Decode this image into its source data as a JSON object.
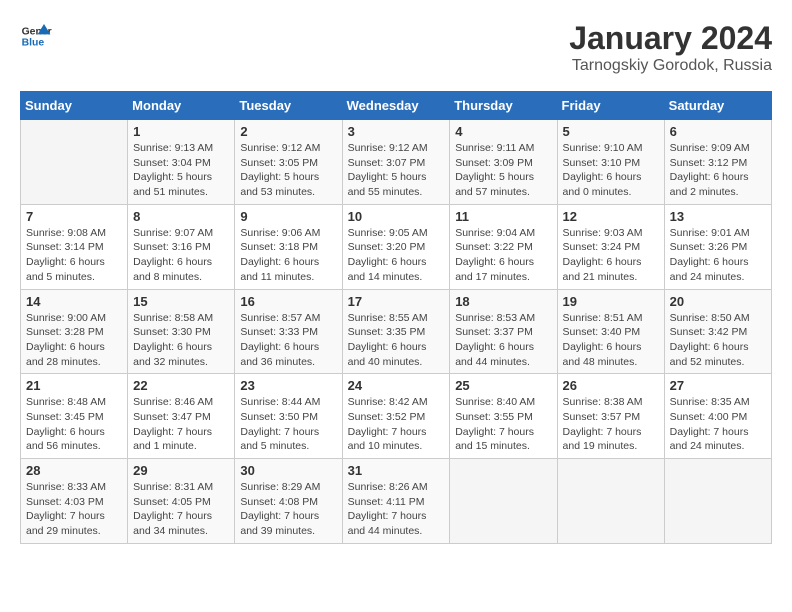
{
  "logo": {
    "line1": "General",
    "line2": "Blue"
  },
  "title": "January 2024",
  "subtitle": "Tarnogskiy Gorodok, Russia",
  "headers": [
    "Sunday",
    "Monday",
    "Tuesday",
    "Wednesday",
    "Thursday",
    "Friday",
    "Saturday"
  ],
  "weeks": [
    [
      {
        "day": "",
        "sunrise": "",
        "sunset": "",
        "daylight": ""
      },
      {
        "day": "1",
        "sunrise": "Sunrise: 9:13 AM",
        "sunset": "Sunset: 3:04 PM",
        "daylight": "Daylight: 5 hours and 51 minutes."
      },
      {
        "day": "2",
        "sunrise": "Sunrise: 9:12 AM",
        "sunset": "Sunset: 3:05 PM",
        "daylight": "Daylight: 5 hours and 53 minutes."
      },
      {
        "day": "3",
        "sunrise": "Sunrise: 9:12 AM",
        "sunset": "Sunset: 3:07 PM",
        "daylight": "Daylight: 5 hours and 55 minutes."
      },
      {
        "day": "4",
        "sunrise": "Sunrise: 9:11 AM",
        "sunset": "Sunset: 3:09 PM",
        "daylight": "Daylight: 5 hours and 57 minutes."
      },
      {
        "day": "5",
        "sunrise": "Sunrise: 9:10 AM",
        "sunset": "Sunset: 3:10 PM",
        "daylight": "Daylight: 6 hours and 0 minutes."
      },
      {
        "day": "6",
        "sunrise": "Sunrise: 9:09 AM",
        "sunset": "Sunset: 3:12 PM",
        "daylight": "Daylight: 6 hours and 2 minutes."
      }
    ],
    [
      {
        "day": "7",
        "sunrise": "Sunrise: 9:08 AM",
        "sunset": "Sunset: 3:14 PM",
        "daylight": "Daylight: 6 hours and 5 minutes."
      },
      {
        "day": "8",
        "sunrise": "Sunrise: 9:07 AM",
        "sunset": "Sunset: 3:16 PM",
        "daylight": "Daylight: 6 hours and 8 minutes."
      },
      {
        "day": "9",
        "sunrise": "Sunrise: 9:06 AM",
        "sunset": "Sunset: 3:18 PM",
        "daylight": "Daylight: 6 hours and 11 minutes."
      },
      {
        "day": "10",
        "sunrise": "Sunrise: 9:05 AM",
        "sunset": "Sunset: 3:20 PM",
        "daylight": "Daylight: 6 hours and 14 minutes."
      },
      {
        "day": "11",
        "sunrise": "Sunrise: 9:04 AM",
        "sunset": "Sunset: 3:22 PM",
        "daylight": "Daylight: 6 hours and 17 minutes."
      },
      {
        "day": "12",
        "sunrise": "Sunrise: 9:03 AM",
        "sunset": "Sunset: 3:24 PM",
        "daylight": "Daylight: 6 hours and 21 minutes."
      },
      {
        "day": "13",
        "sunrise": "Sunrise: 9:01 AM",
        "sunset": "Sunset: 3:26 PM",
        "daylight": "Daylight: 6 hours and 24 minutes."
      }
    ],
    [
      {
        "day": "14",
        "sunrise": "Sunrise: 9:00 AM",
        "sunset": "Sunset: 3:28 PM",
        "daylight": "Daylight: 6 hours and 28 minutes."
      },
      {
        "day": "15",
        "sunrise": "Sunrise: 8:58 AM",
        "sunset": "Sunset: 3:30 PM",
        "daylight": "Daylight: 6 hours and 32 minutes."
      },
      {
        "day": "16",
        "sunrise": "Sunrise: 8:57 AM",
        "sunset": "Sunset: 3:33 PM",
        "daylight": "Daylight: 6 hours and 36 minutes."
      },
      {
        "day": "17",
        "sunrise": "Sunrise: 8:55 AM",
        "sunset": "Sunset: 3:35 PM",
        "daylight": "Daylight: 6 hours and 40 minutes."
      },
      {
        "day": "18",
        "sunrise": "Sunrise: 8:53 AM",
        "sunset": "Sunset: 3:37 PM",
        "daylight": "Daylight: 6 hours and 44 minutes."
      },
      {
        "day": "19",
        "sunrise": "Sunrise: 8:51 AM",
        "sunset": "Sunset: 3:40 PM",
        "daylight": "Daylight: 6 hours and 48 minutes."
      },
      {
        "day": "20",
        "sunrise": "Sunrise: 8:50 AM",
        "sunset": "Sunset: 3:42 PM",
        "daylight": "Daylight: 6 hours and 52 minutes."
      }
    ],
    [
      {
        "day": "21",
        "sunrise": "Sunrise: 8:48 AM",
        "sunset": "Sunset: 3:45 PM",
        "daylight": "Daylight: 6 hours and 56 minutes."
      },
      {
        "day": "22",
        "sunrise": "Sunrise: 8:46 AM",
        "sunset": "Sunset: 3:47 PM",
        "daylight": "Daylight: 7 hours and 1 minute."
      },
      {
        "day": "23",
        "sunrise": "Sunrise: 8:44 AM",
        "sunset": "Sunset: 3:50 PM",
        "daylight": "Daylight: 7 hours and 5 minutes."
      },
      {
        "day": "24",
        "sunrise": "Sunrise: 8:42 AM",
        "sunset": "Sunset: 3:52 PM",
        "daylight": "Daylight: 7 hours and 10 minutes."
      },
      {
        "day": "25",
        "sunrise": "Sunrise: 8:40 AM",
        "sunset": "Sunset: 3:55 PM",
        "daylight": "Daylight: 7 hours and 15 minutes."
      },
      {
        "day": "26",
        "sunrise": "Sunrise: 8:38 AM",
        "sunset": "Sunset: 3:57 PM",
        "daylight": "Daylight: 7 hours and 19 minutes."
      },
      {
        "day": "27",
        "sunrise": "Sunrise: 8:35 AM",
        "sunset": "Sunset: 4:00 PM",
        "daylight": "Daylight: 7 hours and 24 minutes."
      }
    ],
    [
      {
        "day": "28",
        "sunrise": "Sunrise: 8:33 AM",
        "sunset": "Sunset: 4:03 PM",
        "daylight": "Daylight: 7 hours and 29 minutes."
      },
      {
        "day": "29",
        "sunrise": "Sunrise: 8:31 AM",
        "sunset": "Sunset: 4:05 PM",
        "daylight": "Daylight: 7 hours and 34 minutes."
      },
      {
        "day": "30",
        "sunrise": "Sunrise: 8:29 AM",
        "sunset": "Sunset: 4:08 PM",
        "daylight": "Daylight: 7 hours and 39 minutes."
      },
      {
        "day": "31",
        "sunrise": "Sunrise: 8:26 AM",
        "sunset": "Sunset: 4:11 PM",
        "daylight": "Daylight: 7 hours and 44 minutes."
      },
      {
        "day": "",
        "sunrise": "",
        "sunset": "",
        "daylight": ""
      },
      {
        "day": "",
        "sunrise": "",
        "sunset": "",
        "daylight": ""
      },
      {
        "day": "",
        "sunrise": "",
        "sunset": "",
        "daylight": ""
      }
    ]
  ]
}
